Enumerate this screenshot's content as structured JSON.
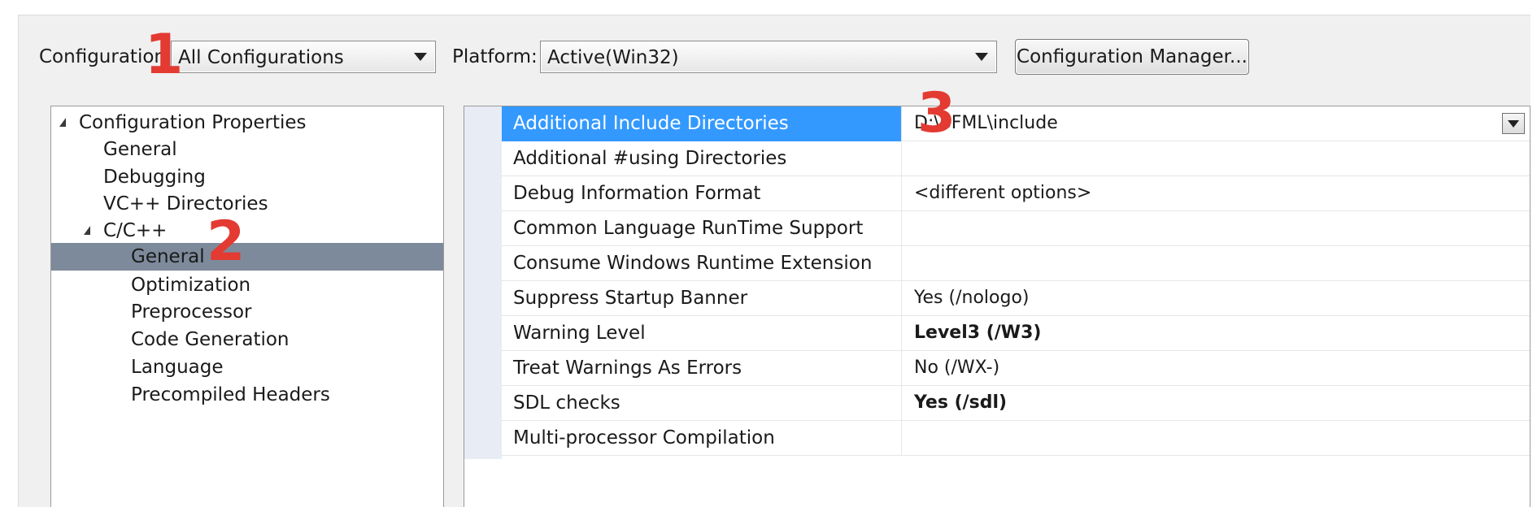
{
  "toolbar": {
    "configuration_label": "Configuration:",
    "configuration_value": "All Configurations",
    "platform_label": "Platform:",
    "platform_value": "Active(Win32)",
    "config_manager_label": "Configuration Manager..."
  },
  "tree": {
    "items": [
      {
        "label": "Configuration Properties",
        "expanded": true
      },
      {
        "label": "General"
      },
      {
        "label": "Debugging"
      },
      {
        "label": "VC++ Directories"
      },
      {
        "label": "C/C++",
        "expanded": true
      },
      {
        "label": "General",
        "selected": true
      },
      {
        "label": "Optimization"
      },
      {
        "label": "Preprocessor"
      },
      {
        "label": "Code Generation"
      },
      {
        "label": "Language"
      },
      {
        "label": "Precompiled Headers"
      }
    ]
  },
  "grid": {
    "rows": [
      {
        "name": "Additional Include Directories",
        "value": "D:\\SFML\\include",
        "selected": true
      },
      {
        "name": "Additional #using Directories",
        "value": ""
      },
      {
        "name": "Debug Information Format",
        "value": "<different options>"
      },
      {
        "name": "Common Language RunTime Support",
        "value": ""
      },
      {
        "name": "Consume Windows Runtime Extension",
        "value": ""
      },
      {
        "name": "Suppress Startup Banner",
        "value": "Yes (/nologo)"
      },
      {
        "name": "Warning Level",
        "value": "Level3 (/W3)",
        "bold": true
      },
      {
        "name": "Treat Warnings As Errors",
        "value": "No (/WX-)"
      },
      {
        "name": "SDL checks",
        "value": "Yes (/sdl)",
        "bold": true
      },
      {
        "name": "Multi-processor Compilation",
        "value": ""
      }
    ]
  },
  "annotations": [
    "1",
    "2",
    "3"
  ],
  "colors": {
    "selection_blue": "#3399ff",
    "tree_selection": "#7d8a9b",
    "annotation_red": "#e33a32"
  }
}
